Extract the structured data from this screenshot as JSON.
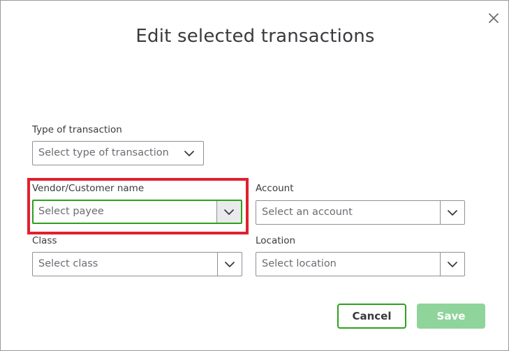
{
  "dialog": {
    "title": "Edit selected transactions",
    "close_icon": "close-icon"
  },
  "fields": {
    "transaction_type": {
      "label": "Type of transaction",
      "placeholder": "Select type of transaction"
    },
    "payee": {
      "label": "Vendor/Customer name",
      "placeholder": "Select payee",
      "state": "focused"
    },
    "account": {
      "label": "Account",
      "placeholder": "Select an account"
    },
    "class": {
      "label": "Class",
      "placeholder": "Select class"
    },
    "location": {
      "label": "Location",
      "placeholder": "Select location"
    }
  },
  "buttons": {
    "cancel_label": "Cancel",
    "save_label": "Save"
  },
  "colors": {
    "accent_green": "#2ca01c",
    "save_disabled_green": "#8fd49a",
    "highlight_red": "#e0202e",
    "text_primary": "#393a3d",
    "placeholder_text": "#6b6c72"
  }
}
